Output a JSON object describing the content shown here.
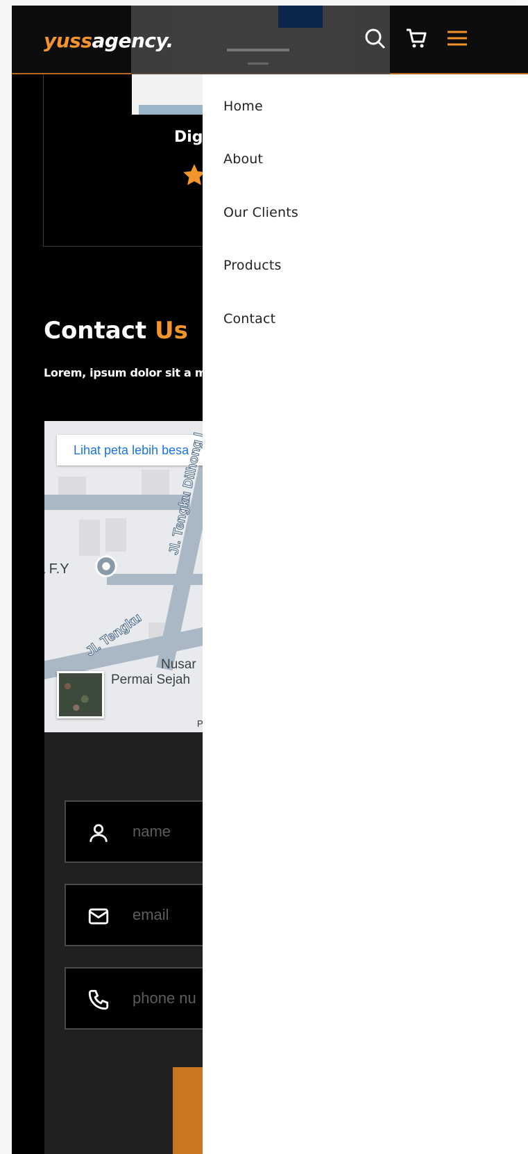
{
  "brand": {
    "logo_accent": "yuss",
    "logo_main": "agency."
  },
  "header": {
    "icons": {
      "search": "search-icon",
      "cart": "shopping-cart-icon",
      "menu": "hamburger-menu-icon"
    },
    "accent_color": "#f3952b"
  },
  "hero": {
    "title_partial": "Dig",
    "rating_icon": "star-icon"
  },
  "contact": {
    "title_main": "Contact ",
    "title_accent": "Us",
    "description": "Lorem, ipsum dolor sit a modi!"
  },
  "map": {
    "enlarge_link": "Lihat peta lebih besa",
    "pin_label": "a F.Y",
    "road_1": "Jl. Tengku Dilhong I",
    "road_2": "Jl. Tengku",
    "place_line1": "Nusar",
    "place_line2": "Permai Sejah",
    "credit": "P"
  },
  "form": {
    "name_placeholder": "name",
    "email_placeholder": "email",
    "phone_placeholder": "phone nu"
  },
  "drawer": {
    "items": [
      {
        "label": "Home"
      },
      {
        "label": "About"
      },
      {
        "label": "Our Clients"
      },
      {
        "label": "Products"
      },
      {
        "label": "Contact"
      }
    ]
  }
}
